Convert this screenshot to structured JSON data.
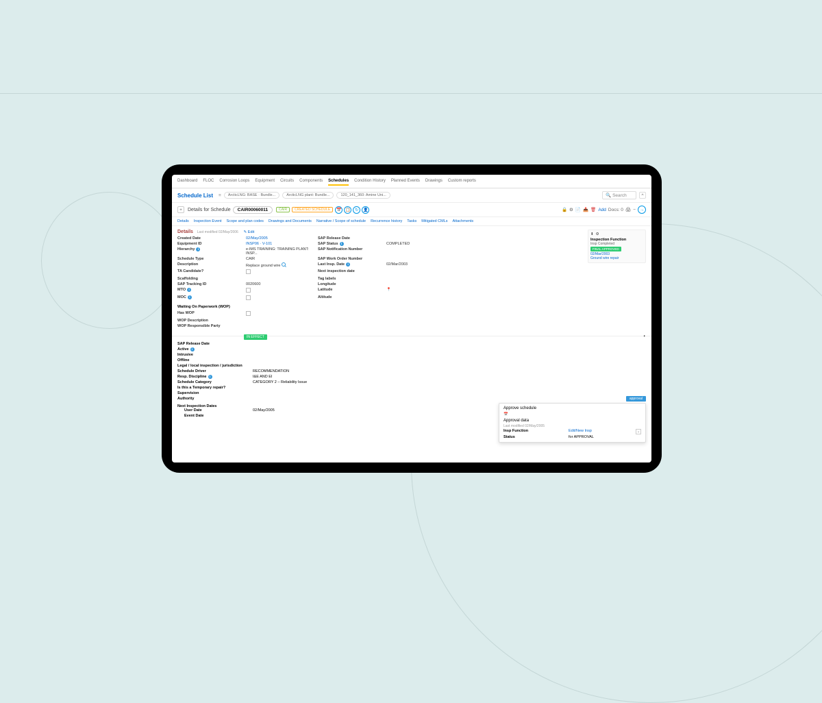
{
  "topnav": {
    "items": [
      "Dashboard",
      "FLOC",
      "Corrosion Loops",
      "Equipment",
      "Circuits",
      "Components",
      "Schedules",
      "Condition History",
      "Planned Events",
      "Drawings",
      "Custom reports"
    ],
    "active_index": 6
  },
  "subhead": {
    "title": "Schedule List",
    "crumbs": [
      "ArcticLNG: BASE · Bundle...",
      "ArcticLNG plant: Bundle...",
      "120_141_360: Amine Uni..."
    ],
    "search_placeholder": "Search",
    "collapse_icon": "^"
  },
  "schedule_bar": {
    "plus": "+",
    "title": "Details for Schedule",
    "id": "CAIR00060011",
    "badge_cair": "CAIR",
    "badge_created": "CREATED SCHEDULE",
    "circle_icons": [
      "📅",
      "📋",
      "↻",
      "👤"
    ],
    "right": {
      "icons": [
        "🔒",
        "⚙",
        "📄",
        "📥",
        "🗑"
      ],
      "add_text": "Add",
      "docs_text": "Docs: 0",
      "print": "🖨",
      "minus": "−",
      "go": "→"
    }
  },
  "tabs": [
    "Details",
    "Inspection Event",
    "Scope and plan codes",
    "Drawings and Documents",
    "Narrative / Scope of schedule",
    "Recurrence history",
    "Tasks",
    "Mitigated CMLs",
    "Attachments"
  ],
  "details": {
    "heading": "Details",
    "modified": "Last modified 02/May/2006",
    "edit": "Edit",
    "kv_left": [
      {
        "k": "Created Date",
        "v": "02/May/2005",
        "link": true
      },
      {
        "k": "Equipment ID",
        "v": "INSP06 · V-101",
        "link": true
      },
      {
        "k": "Hierarchy",
        "v": "e-IMS TRAINING: TRAINING PLANT: INSP...",
        "info": true
      },
      {
        "k": "Schedule Type",
        "v": "CAIR"
      },
      {
        "k": "Description",
        "v": "Replace ground wire",
        "search": true
      },
      {
        "k": "TA Candidate?",
        "v": "",
        "chk": true
      },
      {
        "k": "Scaffolding",
        "v": ""
      },
      {
        "k": "SAP Tracking ID",
        "v": "0020600"
      },
      {
        "k": "MTO",
        "v": "",
        "chk": true,
        "info": true
      },
      {
        "k": "MOC",
        "v": "",
        "chk": true,
        "info": true
      }
    ],
    "kv_right": [
      {
        "k": "SAP Release Date",
        "v": ""
      },
      {
        "k": "SAP Status",
        "v": "COMPLETED",
        "info": true
      },
      {
        "k": "SAP Notification Number",
        "v": ""
      },
      {
        "k": "SAP Work Order Number",
        "v": ""
      },
      {
        "k": "Last Insp. Date",
        "v": "02/Mar/2003",
        "info": true
      },
      {
        "k": "Next inspection date",
        "v": ""
      }
    ],
    "tag_h": "Tag labels",
    "tag_rows": [
      {
        "k": "Longitude",
        "v": ""
      },
      {
        "k": "Latitude",
        "v": "",
        "pin": true
      },
      {
        "k": "Altitude",
        "v": ""
      }
    ],
    "wop_h": "Waiting On Paperwork (WOP)",
    "wop_rows": [
      {
        "k": "Has WOP",
        "v": "",
        "chk": true
      },
      {
        "k": "WOP Description",
        "v": ""
      },
      {
        "k": "WOP Responsible Party",
        "v": ""
      }
    ]
  },
  "side": {
    "icons": [
      "⬇",
      "⚙"
    ],
    "title": "Inspection Function",
    "sub": "Insp Completed",
    "badge": "FINAL APPROVED",
    "date": "02/Mar/2003",
    "note": "Ground wire repair"
  },
  "section": {
    "in_effect": "IN EFFECT",
    "circle": "◐"
  },
  "bottom": {
    "rows": [
      {
        "k": "SAP Release Date",
        "v": ""
      },
      {
        "k": "Active",
        "v": "",
        "chk": true,
        "info": true
      },
      {
        "k": "Intrusive",
        "v": "",
        "chk": true
      },
      {
        "k": "Offline",
        "v": "",
        "chk": true
      },
      {
        "k": "Legal / local inspection / jurisdiction",
        "v": ""
      },
      {
        "k": "Schedule Driver",
        "v": "RECOMMENDATION"
      },
      {
        "k": "Resp. Discipline",
        "v": "I&E AND EI",
        "info": true
      },
      {
        "k": "Schedule Category",
        "v": "CATEGORY 2 – Reliability Issue"
      },
      {
        "k": "Is this a Temporary repair?",
        "v": "",
        "chk": true
      },
      {
        "k": "Supervision",
        "v": "",
        "chk": true
      },
      {
        "k": "Authority",
        "v": "",
        "chk": true
      }
    ],
    "next_h": "Next Inspection Dates",
    "next_rows": [
      {
        "k": "User Date",
        "v": "02/May/2005"
      },
      {
        "k": "Event Date",
        "v": ""
      }
    ]
  },
  "approval_tag": "approval",
  "popup": {
    "title": "Approve schedule",
    "cal": "📅",
    "sect": "Approval data",
    "modified": "Last modified 02/May/2005",
    "rows": [
      {
        "k": "Insp Function",
        "v": "Edit/New Insp",
        "dd": true
      },
      {
        "k": "Status",
        "v": "for APPROVAL"
      }
    ]
  }
}
